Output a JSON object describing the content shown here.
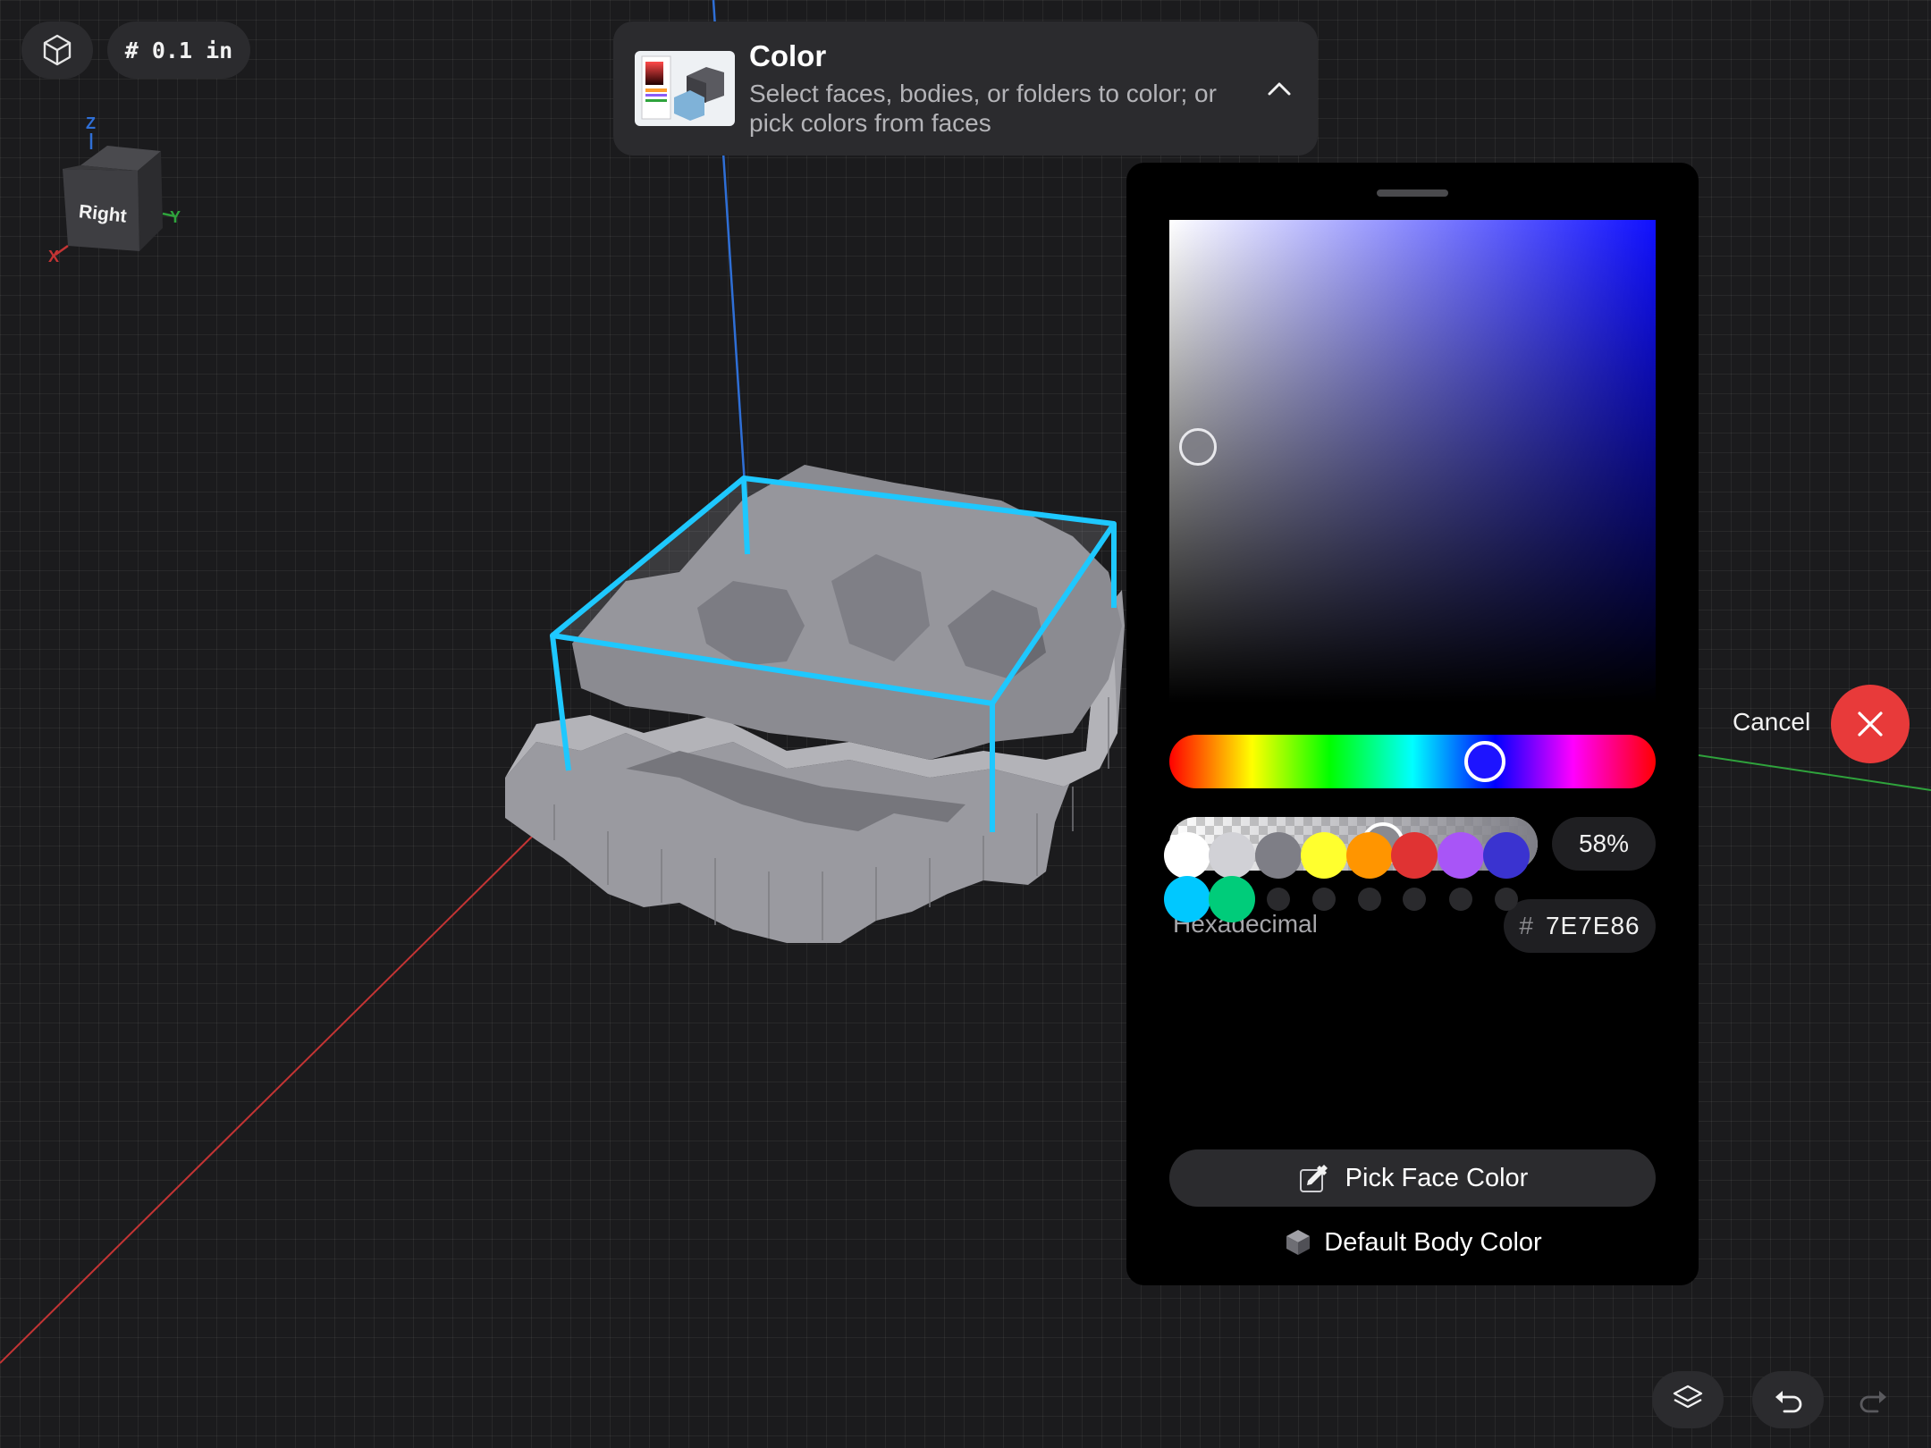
{
  "toolbar": {
    "view_mode_icon": "view-cube-icon",
    "grid_label": "# 0.1 in"
  },
  "view_cube": {
    "face_label": "Right",
    "axis_z": "Z",
    "axis_y": "Y",
    "axis_x": "X",
    "axis_z_color": "#2f6fd6",
    "axis_y_color": "#2fa33c",
    "axis_x_color": "#c43434"
  },
  "tool_header": {
    "title": "Color",
    "description": "Select faces, bodies, or folders to color; or pick colors from faces",
    "collapse_icon": "chevron-up-icon"
  },
  "color_panel": {
    "selected_hue_color": "#1d14ff",
    "selected_alpha_fraction": 0.58,
    "alpha_label": "58%",
    "hex_label": "Hexadecimal",
    "hex_hash": "#",
    "hex_value": "7E7E86",
    "swatches": [
      {
        "color": "#ffffff",
        "name": "white"
      },
      {
        "color": "#d1d1d6",
        "name": "light-gray"
      },
      {
        "color": "#7e7e86",
        "name": "gray"
      },
      {
        "color": "#ffff2e",
        "name": "yellow"
      },
      {
        "color": "#ff9500",
        "name": "orange"
      },
      {
        "color": "#e03333",
        "name": "red"
      },
      {
        "color": "#a855f7",
        "name": "purple"
      },
      {
        "color": "#3a33d0",
        "name": "blue"
      },
      {
        "color": "#00c8ff",
        "name": "cyan"
      },
      {
        "color": "#00cc7a",
        "name": "green"
      }
    ],
    "empty_swatch_count": 6,
    "pick_face_label": "Pick Face Color",
    "pick_face_icon": "eyedropper-icon",
    "default_body_label": "Default Body Color",
    "default_body_icon": "cube-icon"
  },
  "cancel": {
    "label": "Cancel",
    "icon": "close-icon",
    "color": "#e83a3a"
  },
  "bottom_bar": {
    "layers_icon": "layers-icon",
    "undo_icon": "undo-icon",
    "redo_icon": "redo-icon"
  },
  "model": {
    "selection_color": "#1ec8ff"
  }
}
